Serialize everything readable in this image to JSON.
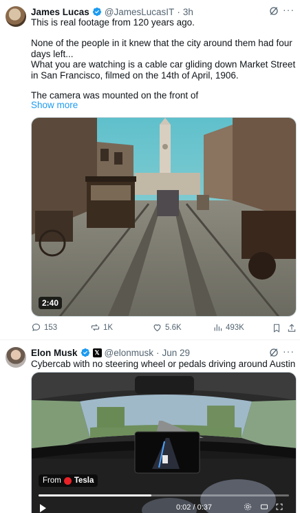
{
  "tweet1": {
    "name": "James Lucas",
    "handle": "@JamesLucasIT",
    "dot": "·",
    "time": "3h",
    "paragraphs": [
      "This is real footage from 120 years ago.",
      "None of the people in it knew that the city around them had four days left...",
      "What you are watching is a cable car gliding down Market Street in San Francisco, filmed on the 14th of April, 1906.",
      "The camera was mounted on the front of"
    ],
    "show_more": "Show more",
    "video_duration": "2:40",
    "replies": "153",
    "reposts": "1K",
    "likes": "5.6K",
    "views": "493K"
  },
  "tweet2": {
    "name": "Elon Musk",
    "handle": "@elonmusk",
    "dot": "·",
    "time": "Jun 29",
    "text": "Cybercab with no steering wheel or pedals driving around Austin",
    "from_label": "From",
    "from_source": "Tesla",
    "progress": 0.45,
    "time_readout": "0:02 / 0:37"
  },
  "colors": {
    "accent": "#1d9bf0",
    "secondary_text": "#536471",
    "tesla_red": "#e82127"
  }
}
